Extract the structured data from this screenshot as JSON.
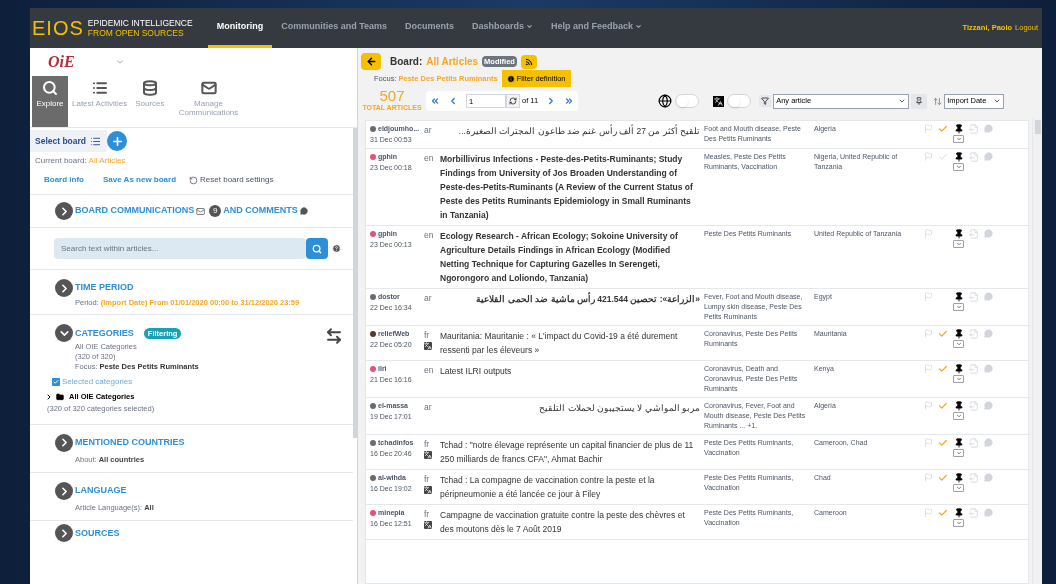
{
  "header": {
    "logo_mark": "EIOS",
    "logo_line1": "EPIDEMIC INTELLIGENCE",
    "logo_line2": "FROM OPEN SOURCES",
    "nav": [
      {
        "label": "Monitoring",
        "selected": true,
        "dropdown": false
      },
      {
        "label": "Communities and Teams",
        "selected": false,
        "dropdown": false
      },
      {
        "label": "Documents",
        "selected": false,
        "dropdown": false
      },
      {
        "label": "Dashboards",
        "selected": false,
        "dropdown": true
      },
      {
        "label": "Help and Feedback",
        "selected": false,
        "dropdown": true
      }
    ],
    "user": "Tizzani, Paolo",
    "logout": "Logout"
  },
  "sidebar": {
    "org_logo": "OiE",
    "tabs": [
      {
        "label": "Explore",
        "selected": true
      },
      {
        "label": "Latest Activities",
        "selected": false
      },
      {
        "label": "Sources",
        "selected": false
      },
      {
        "label": "Manage Communications",
        "selected": false
      }
    ],
    "select_board": "Select board",
    "current_board_label": "Current board:",
    "current_board": "All Articles",
    "links": [
      "Board info",
      "Save As new board"
    ],
    "reset": "Reset board settings",
    "communications": {
      "title": "BOARD COMMUNICATIONS",
      "count": "9",
      "title2": "AND COMMENTS",
      "expanded": false
    },
    "search": {
      "placeholder": "Search text within articles..."
    },
    "time_period": {
      "title": "TIME PERIOD",
      "expanded": false,
      "label": "Period:",
      "value": "(Import Date) From 01/01/2020 00:00 to 31/12/2020 23:59"
    },
    "categories": {
      "title": "CATEGORIES",
      "expanded": true,
      "badge": "Filtering",
      "line1": "All OIE Categories",
      "line2": "(320 of 320)",
      "focus_label": "Focus:",
      "focus": "Peste Des Petits Ruminants",
      "checkbox": {
        "label": "Selected categories",
        "checked": true
      },
      "tree": {
        "label": "All OIE Categories",
        "note": "(320 of 320 categories selected)",
        "expanded": false
      }
    },
    "countries": {
      "title": "MENTIONED COUNTRIES",
      "expanded": false,
      "label": "About:",
      "value": "All countries"
    },
    "language": {
      "title": "LANGUAGE",
      "expanded": false,
      "label": "Article Language(s):",
      "value": "All"
    },
    "sources": {
      "title": "SOURCES",
      "expanded": false
    }
  },
  "board": {
    "label": "Board:",
    "name": "All Articles",
    "badge": "Modified",
    "focus_label": "Focus:",
    "focus": "Peste Des Petits Ruminants",
    "filter_button": "Filter definition",
    "total": "507",
    "total_label": "TOTAL ARTICLES",
    "page": "1",
    "of_pages": "of 11",
    "map_toggle": {
      "on": false
    },
    "translate_toggle": {
      "on": false
    },
    "article_filter": "Any article",
    "sort": "Import Date"
  },
  "articles": [
    {
      "source": "eldjoumho...",
      "color": "#6b6b6b",
      "date": "31 Dec 00:53",
      "lang": "ar",
      "translated": false,
      "rtl": true,
      "bold": false,
      "title": "تلقيح أكثر من 27 ألف رأس غنم ضد طاعون المجترات الصغيرة...",
      "categories": "Foot and Mouth disease, Peste Des Petits Ruminants",
      "countries": "Algeria",
      "validated": true
    },
    {
      "source": "gphin",
      "color": "#e8507a",
      "date": "23 Dec 00:18",
      "lang": "en",
      "translated": false,
      "rtl": false,
      "bold": true,
      "title": "Morbillivirus Infections - Peste-des-Petits-Ruminants; Study Findings from University of Jos Broaden Understanding of Peste-des-Petits-Ruminants (A Review of the Current Status of Peste des Petits Ruminants Epidemiology in Small Ruminants in Tanzania)",
      "categories": "Measles, Peste Des Petits Ruminants, Vaccination",
      "countries": "Nigeria, United Republic of Tanzania",
      "validated": false
    },
    {
      "source": "gphin",
      "color": "#e8507a",
      "date": "23 Dec 00:13",
      "lang": "en",
      "translated": false,
      "rtl": false,
      "bold": true,
      "title": "Ecology Research - African Ecology; Sokoine University of Agriculture Details Findings in African Ecology (Modified Netting Technique for Capturing Gazelles In Serengeti, Ngorongoro and Loliondo, Tanzania)",
      "categories": "Peste Des Petits Ruminants",
      "countries": "United Republic of Tanzania"
    },
    {
      "source": "dostor",
      "color": "#6b6b6b",
      "date": "22 Dec 16:34",
      "lang": "ar",
      "translated": false,
      "rtl": true,
      "bold": true,
      "title": "«الزراعة»: تحصين 421.544 رأس ماشية ضد الحمى القلاعية",
      "categories": "Fever, Foot and Mouth disease, Lumpy skin disease, Peste Des Petits Ruminants",
      "countries": "Egypt"
    },
    {
      "source": "reliefWeb",
      "color": "#5a3a2e",
      "date": "22 Dec 05:20",
      "lang": "fr",
      "translated": true,
      "rtl": false,
      "bold": false,
      "title": "Mauritania: Mauritanie : « L'impact du Covid-19 a été durement ressenti par les éleveurs »",
      "categories": "Coronavirus, Peste Des Petits Ruminants",
      "countries": "Mauritania",
      "validated": true
    },
    {
      "source": "ilri",
      "color": "#e8507a",
      "date": "21 Dec 16:16",
      "lang": "en",
      "translated": false,
      "rtl": false,
      "bold": false,
      "title": "Latest ILRI outputs",
      "categories": "Coronavirus, Death and Coronavirus, Peste Des Petits Ruminants",
      "countries": "Kenya",
      "validated": true
    },
    {
      "source": "el-massa",
      "color": "#6b6b6b",
      "date": "19 Dec 17:01",
      "lang": "ar",
      "translated": false,
      "rtl": true,
      "bold": false,
      "title": "مربو المواشي لا يستجيبون لحملات التلقيح",
      "categories": "Coronavirus, Fever, Foot and Mouth disease, Peste Des Petits Ruminants ... +1.",
      "countries": "Algeria",
      "validated": true
    },
    {
      "source": "tchadinfos",
      "color": "#6b6b6b",
      "date": "16 Dec 20:46",
      "lang": "fr",
      "translated": true,
      "rtl": false,
      "bold": false,
      "title": "Tchad : \"notre élevage représente un capital financier de plus de 11 250 milliards de francs CFA\", Ahmat Bachir",
      "categories": "Peste Des Petits Ruminants, Vaccination",
      "countries": "Cameroon, Chad",
      "validated": true
    },
    {
      "source": "al-wihda",
      "color": "#6b6b6b",
      "date": "16 Dec 19:02",
      "lang": "fr",
      "translated": true,
      "rtl": false,
      "bold": false,
      "title": "Tchad : La compagne de vaccination contre la peste et la péripneumonie a été lancée ce jour à Filey",
      "categories": "Peste Des Petits Ruminants, Vaccination",
      "countries": "Chad",
      "validated": true
    },
    {
      "source": "minepia",
      "color": "#e8507a",
      "date": "16 Dec 12:51",
      "lang": "fr",
      "translated": true,
      "rtl": false,
      "bold": false,
      "title": "Campagne de vaccination gratuite contre la peste des chèvres et des moutons dès le 7 Août 2019",
      "categories": "Peste Des Petits Ruminants, Vaccination",
      "countries": "Cameroon",
      "validated": true
    }
  ]
}
